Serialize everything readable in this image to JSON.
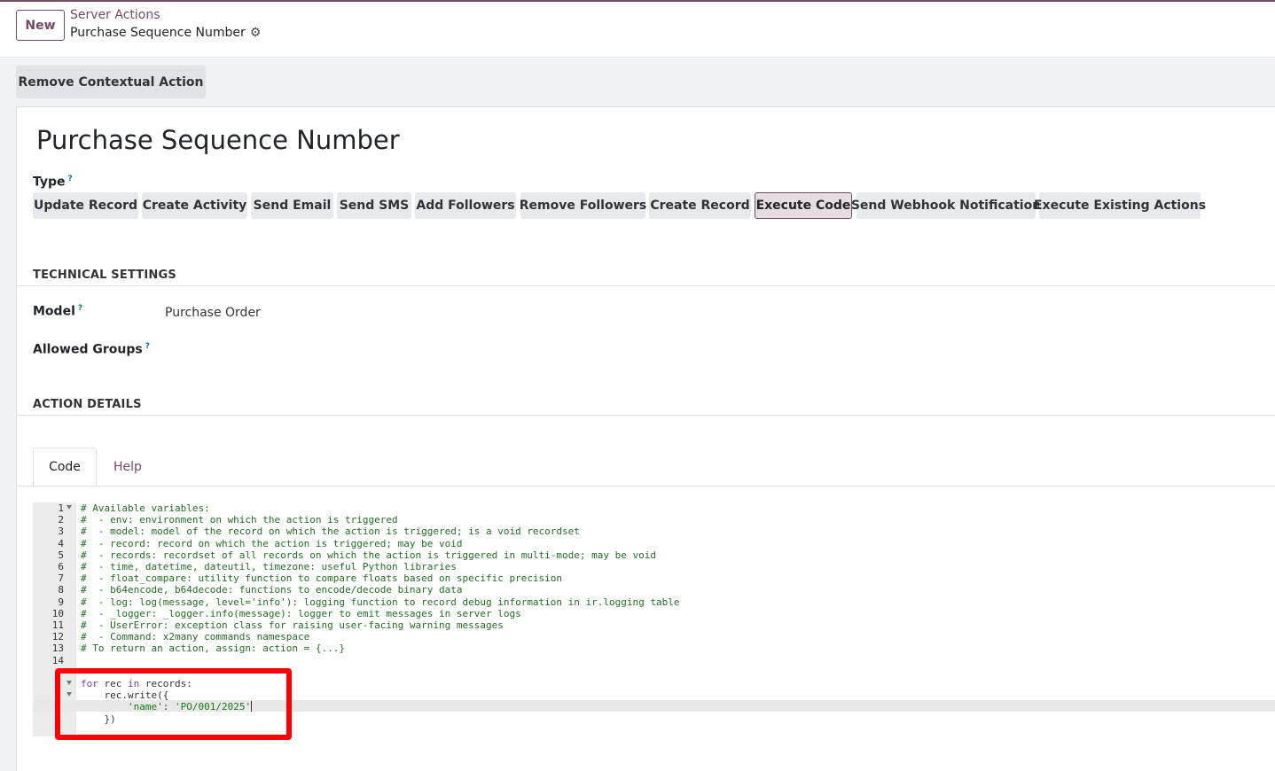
{
  "control_panel": {
    "new_label": "New",
    "breadcrumb_parent": "Server Actions",
    "breadcrumb_current": "Purchase Sequence Number"
  },
  "actions": {
    "remove_contextual": "Remove Contextual Action"
  },
  "form": {
    "title": "Purchase Sequence Number",
    "type_label": "Type",
    "type_options": [
      "Update Record",
      "Create Activity",
      "Send Email",
      "Send SMS",
      "Add Followers",
      "Remove Followers",
      "Create Record",
      "Execute Code",
      "Send Webhook Notification",
      "Execute Existing Actions"
    ],
    "type_selected": "Execute Code",
    "technical_settings": "TECHNICAL SETTINGS",
    "model_label": "Model",
    "model_value": "Purchase Order",
    "allowed_groups_label": "Allowed Groups",
    "action_details": "ACTION DETAILS",
    "tabs": [
      "Code",
      "Help"
    ]
  },
  "editor": {
    "lines": [
      "# Available variables:",
      "#  - env: environment on which the action is triggered",
      "#  - model: model of the record on which the action is triggered; is a void recordset",
      "#  - record: record on which the action is triggered; may be void",
      "#  - records: recordset of all records on which the action is triggered in multi-mode; may be void",
      "#  - time, datetime, dateutil, timezone: useful Python libraries",
      "#  - float_compare: utility function to compare floats based on specific precision",
      "#  - b64encode, b64decode: functions to encode/decode binary data",
      "#  - log: log(message, level='info'): logging function to record debug information in ir.logging table",
      "#  - _logger: _logger.info(message): logger to emit messages in server logs",
      "#  - UserError: exception class for raising user-facing warning messages",
      "#  - Command: x2many commands namespace",
      "# To return an action, assign: action = {...}",
      "",
      "",
      "for rec in records:",
      "    rec.write({",
      "        'name': 'PO/001/2025'",
      "    })"
    ],
    "line_numbers": [
      "1",
      "2",
      "3",
      "4",
      "5",
      "6",
      "7",
      "8",
      "9",
      "10",
      "11",
      "12",
      "13",
      "14"
    ]
  }
}
